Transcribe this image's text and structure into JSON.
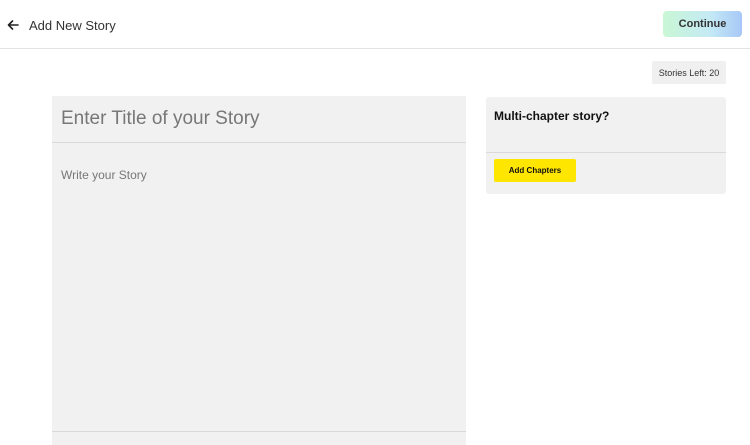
{
  "header": {
    "back_icon": "arrow-left-icon",
    "title": "Add New Story",
    "continue_label": "Continue",
    "continue_gradient": [
      "#c9f7d5",
      "#a7c8f7"
    ]
  },
  "quota": {
    "stories_left_text": "Stories Left: 20"
  },
  "editor": {
    "title_placeholder": "Enter Title of your Story",
    "title_value": "",
    "story_placeholder": "Write your Story",
    "story_value": ""
  },
  "chapters": {
    "heading": "Multi-chapter story?",
    "add_label": "Add Chapters",
    "add_color": "#ffe600"
  }
}
